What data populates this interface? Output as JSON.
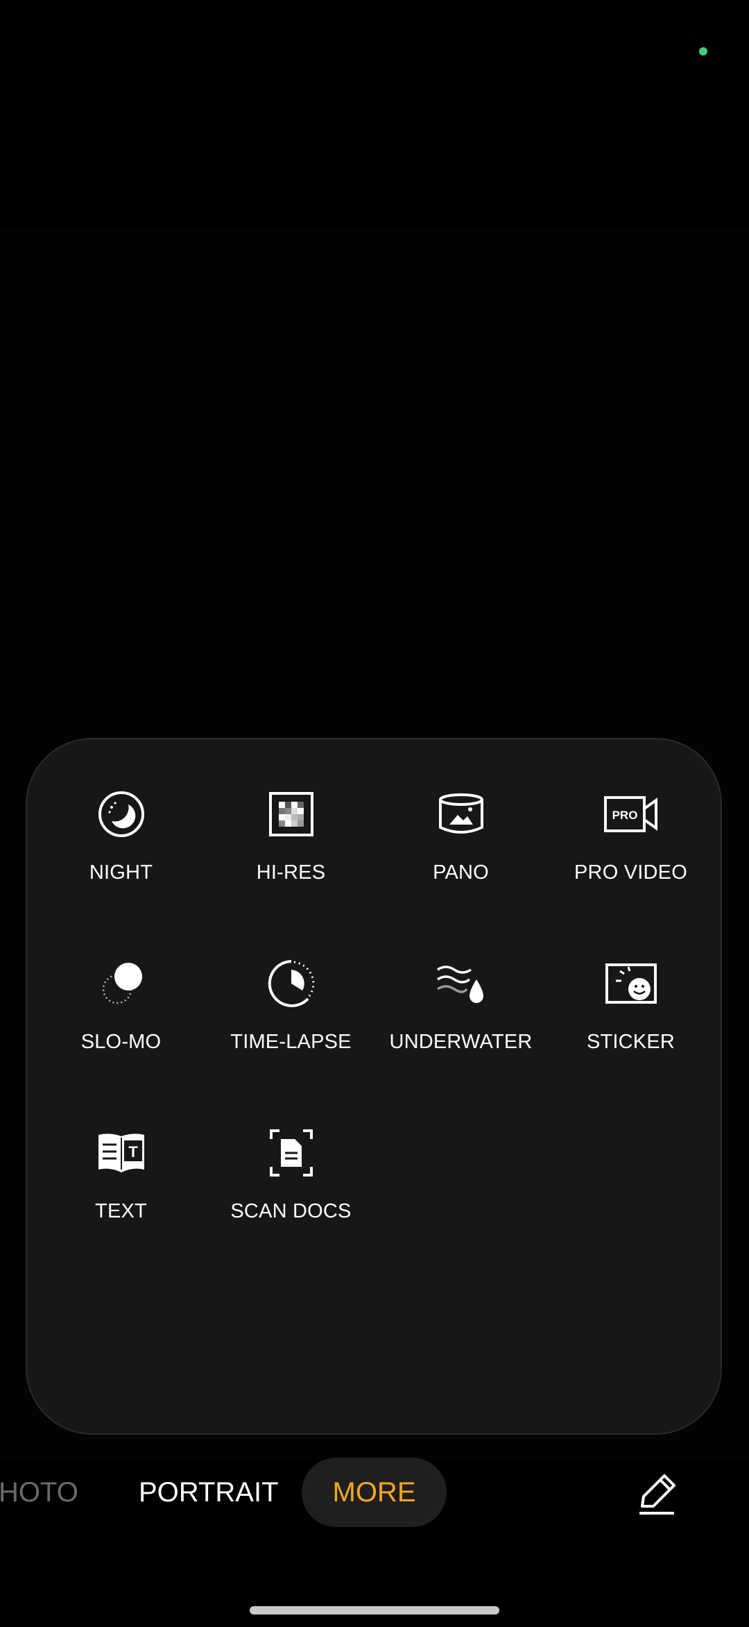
{
  "status": {
    "indicator_color": "#3fd07a"
  },
  "modes_panel": {
    "items": [
      {
        "label": "NIGHT",
        "icon": "night-icon"
      },
      {
        "label": "HI-RES",
        "icon": "hi-res-icon"
      },
      {
        "label": "PANO",
        "icon": "pano-icon"
      },
      {
        "label": "PRO VIDEO",
        "icon": "pro-video-icon",
        "icon_text": "PRO"
      },
      {
        "label": "SLO-MO",
        "icon": "slo-mo-icon"
      },
      {
        "label": "TIME-LAPSE",
        "icon": "time-lapse-icon"
      },
      {
        "label": "UNDERWATER",
        "icon": "underwater-icon"
      },
      {
        "label": "STICKER",
        "icon": "sticker-icon"
      },
      {
        "label": "TEXT",
        "icon": "text-icon",
        "icon_text": "T"
      },
      {
        "label": "SCAN DOCS",
        "icon": "scan-docs-icon"
      }
    ]
  },
  "mode_bar": {
    "tabs": [
      {
        "label": "HOTO"
      },
      {
        "label": "PORTRAIT"
      },
      {
        "label": "MORE",
        "active": true
      }
    ],
    "active_color": "#f5a623",
    "edit_icon": "pencil-icon"
  }
}
